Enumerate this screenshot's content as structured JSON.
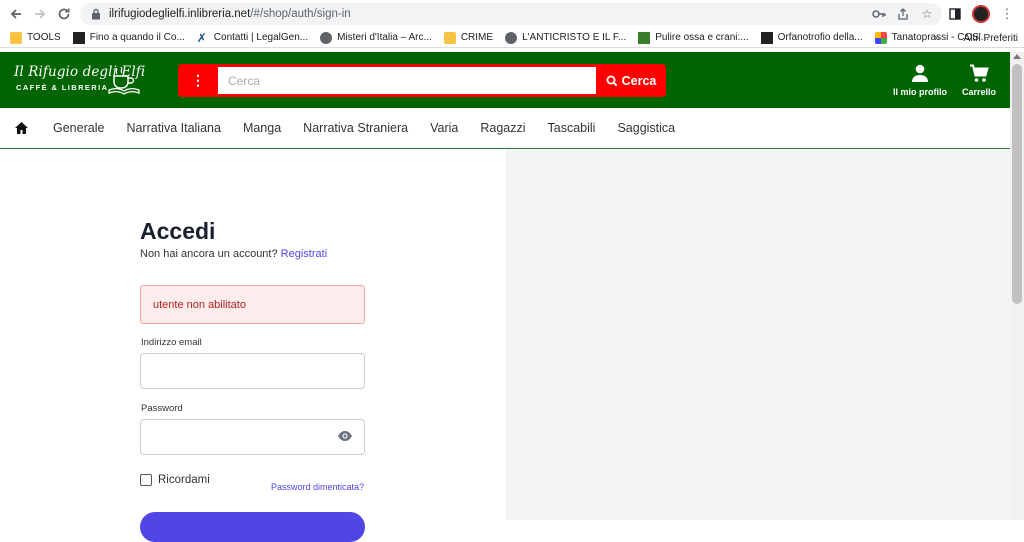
{
  "browser": {
    "url_host": "ilrifugiodeglielfi.inlibreria.net",
    "url_path": "/#/shop/auth/sign-in",
    "bookmarks": [
      {
        "label": "TOOLS",
        "icon": "folder-icon"
      },
      {
        "label": "Fino a quando il Co...",
        "icon": "page-icon"
      },
      {
        "label": "Contatti | LegalGen...",
        "icon": "x-logo-icon"
      },
      {
        "label": "Misteri d'Italia – Arc...",
        "icon": "globe-icon"
      },
      {
        "label": "CRIME",
        "icon": "folder-icon"
      },
      {
        "label": "L'ANTICRISTO E IL F...",
        "icon": "globe-icon"
      },
      {
        "label": "Pulire ossa e crani:...",
        "icon": "site-icon"
      },
      {
        "label": "Orfanotrofio della...",
        "icon": "site-icon"
      },
      {
        "label": "Tanatoprassi - COS'...",
        "icon": "joomla-icon"
      }
    ],
    "bookmarks_more": "»",
    "other_bookmarks": "Altri Preferiti"
  },
  "site": {
    "logo_line1": "Il Rifugio degli Elfi",
    "logo_line2": "CAFFÈ & LIBRERIA",
    "search_placeholder": "Cerca",
    "search_button": "Cerca",
    "profile_label": "Il mio profilo",
    "cart_label": "Carrello",
    "categories": [
      "Generale",
      "Narrativa Italiana",
      "Manga",
      "Narrativa Straniera",
      "Varia",
      "Ragazzi",
      "Tascabili",
      "Saggistica"
    ]
  },
  "login": {
    "title": "Accedi",
    "no_account_text": "Non hai ancora un account?",
    "register_link": "Registrati",
    "error_message": "utente non abilitato",
    "email_label": "Indirizzo email",
    "email_value": "",
    "password_label": "Password",
    "password_value": "",
    "remember_label": "Ricordami",
    "remember_checked": false,
    "forgot_link": "Password dimenticata?"
  },
  "colors": {
    "header_green": "#006400",
    "search_red": "#ff0000",
    "accent_indigo": "#4f46e5",
    "error_bg": "#fdecec"
  }
}
